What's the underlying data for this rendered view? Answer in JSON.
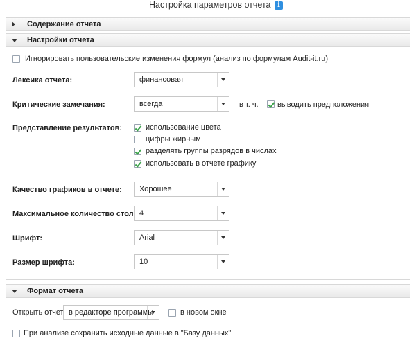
{
  "header": {
    "title": "Настройка параметров отчета",
    "info_icon": "info-icon"
  },
  "sections": {
    "content": {
      "label": "Содержание отчета"
    },
    "settings": {
      "label": "Настройки отчета"
    },
    "format": {
      "label": "Формат отчета"
    }
  },
  "settings": {
    "ignore_changes": {
      "label": "Игнорировать пользовательские изменения формул (анализ по формулам Audit-it.ru)",
      "checked": false
    },
    "lexicon": {
      "label": "Лексика отчета:",
      "value": "финансовая"
    },
    "critical": {
      "label": "Критические замечания:",
      "value": "всегда",
      "incl_label": "в т. ч.",
      "assumptions_label": "выводить предположения",
      "assumptions_checked": true
    },
    "presentation": {
      "label": "Представление результатов:",
      "options": [
        {
          "label": "использование цвета",
          "checked": true
        },
        {
          "label": "цифры жирным",
          "checked": false
        },
        {
          "label": "разделять группы разрядов в числах",
          "checked": true
        },
        {
          "label": "использовать в отчете графику",
          "checked": true
        }
      ]
    },
    "chart_quality": {
      "label": "Качество графиков в отчете:",
      "value": "Хорошее"
    },
    "max_columns": {
      "label": "Максимальное количество столбцов:",
      "value": "4"
    },
    "font": {
      "label": "Шрифт:",
      "value": "Arial"
    },
    "font_size": {
      "label": "Размер шрифта:",
      "value": "10"
    }
  },
  "format": {
    "open_label": "Открыть отчет:",
    "open_value": "в редакторе программы",
    "new_window_label": "в новом окне",
    "new_window_checked": false,
    "save_source_label": "При анализе сохранить исходные данные в \"Базу данных\"",
    "save_source_checked": false
  },
  "colors": {
    "accent": "#2f8fe0",
    "check": "#3aa24a",
    "header_bg": "#eeeeee"
  }
}
